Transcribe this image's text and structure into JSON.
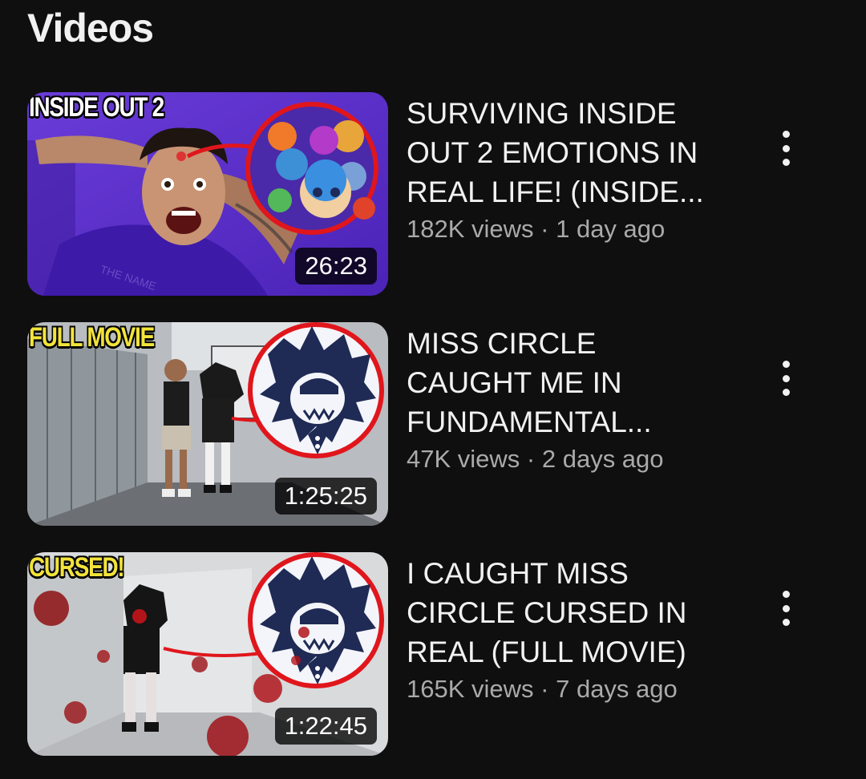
{
  "section": {
    "title": "Videos"
  },
  "videos": [
    {
      "thumbnail_tag": "INSIDE OUT 2",
      "tag_color": "#ffffff",
      "duration": "26:23",
      "title": "SURVIVING INSIDE\nOUT 2 EMOTIONS IN\nREAL LIFE! (INSIDE...",
      "views": "182K views",
      "age": "1 day ago",
      "menu_icon": "more-vertical-icon"
    },
    {
      "thumbnail_tag": "FULL MOVIE",
      "tag_color": "#f2e33a",
      "duration": "1:25:25",
      "title": "MISS CIRCLE\nCAUGHT ME IN\nFUNDAMENTAL...",
      "views": "47K views",
      "age": "2 days ago",
      "menu_icon": "more-vertical-icon"
    },
    {
      "thumbnail_tag": "CURSED!",
      "tag_color": "#f2e33a",
      "duration": "1:22:45",
      "title": "I CAUGHT MISS\nCIRCLE CURSED IN\nREAL (FULL MOVIE)",
      "views": "165K views",
      "age": "7 days ago",
      "menu_icon": "more-vertical-icon"
    }
  ],
  "separator": " · ",
  "colors": {
    "background": "#0f0f0f",
    "text_primary": "#f1f1f1",
    "text_secondary": "#aaaaaa",
    "highlight_circle": "#e0161c"
  }
}
